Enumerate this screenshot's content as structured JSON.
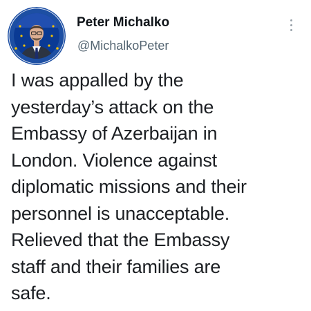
{
  "author": {
    "name": "Peter Michalko",
    "handle": "@MichalkoPeter",
    "avatar_icon": "profile-photo-eu-flag"
  },
  "menu": {
    "icon": "more-vertical-icon"
  },
  "tweet": {
    "lines": [
      "I was appalled by the",
      "yesterday’s attack on the",
      "Embassy of Azerbaijan in",
      "London. Violence against",
      "diplomatic missions and their",
      "personnel is unacceptable.",
      "Relieved that the Embassy",
      "staff and their families are",
      "safe."
    ]
  },
  "colors": {
    "name": "#0f1419",
    "handle": "#536471",
    "body_text": "#1c1f23",
    "avatar_ring": "#1d4fa3",
    "eu_blue": "#0a3a94",
    "eu_star": "#f2c200"
  }
}
